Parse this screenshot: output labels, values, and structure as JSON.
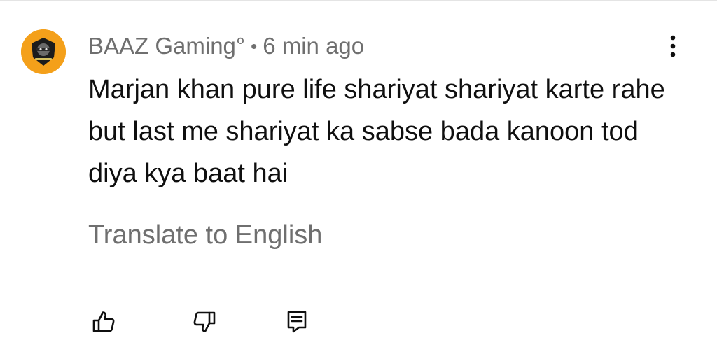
{
  "comment": {
    "author": "BAAZ Gaming°",
    "separator": "•",
    "time": "6 min ago",
    "text": "Marjan khan pure life shariyat shariyat karte rahe but last me shariyat ka sabse bada kanoon tod diya kya baat hai",
    "translate_label": "Translate to English"
  },
  "icons": {
    "avatar": "gaming-logo-avatar",
    "more": "more-vert-icon",
    "like": "thumbs-up-icon",
    "dislike": "thumbs-down-icon",
    "reply": "reply-comment-icon"
  },
  "colors": {
    "text_primary": "#0f0f0f",
    "text_secondary": "#6f6f6f",
    "avatar_bg": "#f4a01a"
  }
}
